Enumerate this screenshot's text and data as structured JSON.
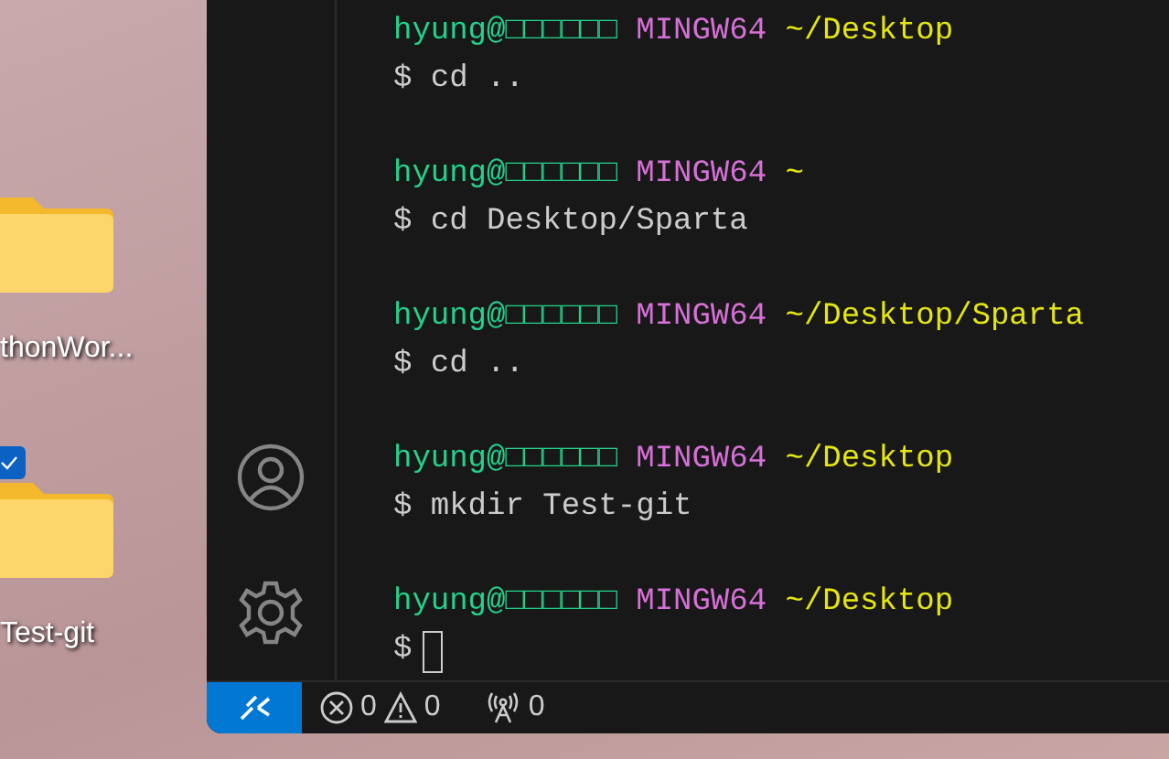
{
  "desktop_icons": [
    {
      "label": "thonWor...",
      "selected": false
    },
    {
      "label": "Test-git",
      "selected": true
    }
  ],
  "terminal": {
    "blocks": [
      {
        "user": "hyung@□□□□□□",
        "system": "MINGW64",
        "path": "~/Desktop",
        "prompt": "$",
        "command": "cd .."
      },
      {
        "user": "hyung@□□□□□□",
        "system": "MINGW64",
        "path": "~",
        "prompt": "$",
        "command": "cd Desktop/Sparta"
      },
      {
        "user": "hyung@□□□□□□",
        "system": "MINGW64",
        "path": "~/Desktop/Sparta",
        "prompt": "$",
        "command": "cd .."
      },
      {
        "user": "hyung@□□□□□□",
        "system": "MINGW64",
        "path": "~/Desktop",
        "prompt": "$",
        "command": "mkdir Test-git"
      },
      {
        "user": "hyung@□□□□□□",
        "system": "MINGW64",
        "path": "~/Desktop",
        "prompt": "$",
        "cursor": true
      }
    ]
  },
  "status_bar": {
    "errors": "0",
    "warnings": "0",
    "ports": "0"
  }
}
